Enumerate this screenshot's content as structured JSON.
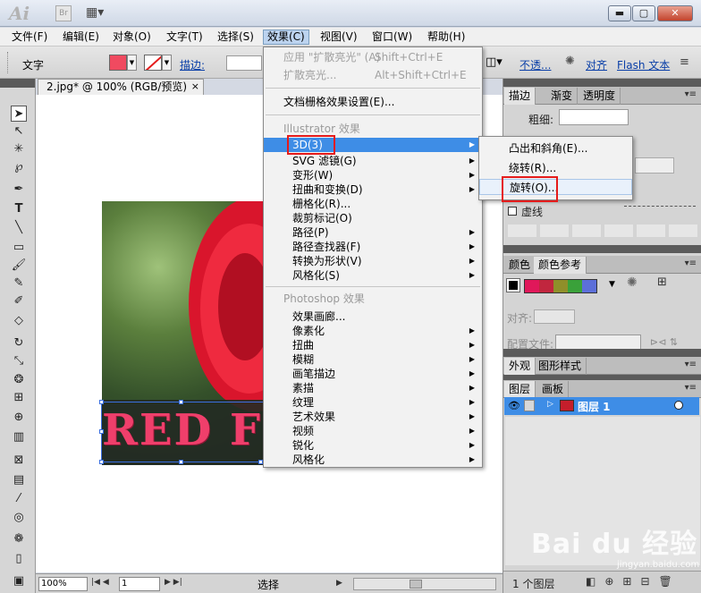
{
  "window": {
    "app_logo": "Ai",
    "bridge_label": "Br",
    "layout_icon": "layout-grid-icon",
    "buttons": [
      "minimize",
      "restore",
      "close"
    ]
  },
  "menubar": {
    "items": [
      "文件(F)",
      "编辑(E)",
      "对象(O)",
      "文字(T)",
      "选择(S)",
      "效果(C)",
      "视图(V)",
      "窗口(W)",
      "帮助(H)"
    ],
    "active": "效果(C)"
  },
  "controlbar": {
    "tool_label": "文字",
    "fill_color": "#f04a60",
    "stroke_label": "描边:",
    "opacity_label": "不透...",
    "align_label": "对齐",
    "flash_label": "Flash 文本"
  },
  "document": {
    "tab_title": "2.jpg* @ 100% (RGB/预览)",
    "close_glyph": "×",
    "overlay_text": "RED FL"
  },
  "statusbar": {
    "zoom": "100%",
    "page": "1",
    "status": "选择"
  },
  "effect_menu": {
    "top_items": [
      {
        "label": "应用 \"扩散亮光\" (A)",
        "shortcut": "Shift+Ctrl+E",
        "disabled": true
      },
      {
        "label": "扩散亮光...",
        "shortcut": "Alt+Shift+Ctrl+E",
        "disabled": true
      }
    ],
    "doc_settings": "文档栅格效果设置(E)...",
    "illustrator_header": "Illustrator 效果",
    "illustrator_items": [
      "3D(3)",
      "SVG 滤镜(G)",
      "变形(W)",
      "扭曲和变换(D)",
      "栅格化(R)...",
      "裁剪标记(O)",
      "路径(P)",
      "路径查找器(F)",
      "转换为形状(V)",
      "风格化(S)"
    ],
    "photoshop_header": "Photoshop 效果",
    "photoshop_items": [
      "效果画廊...",
      "像素化",
      "扭曲",
      "模糊",
      "画笔描边",
      "素描",
      "纹理",
      "艺术效果",
      "视频",
      "锐化",
      "风格化"
    ],
    "highlighted": "3D(3)"
  },
  "submenu_3d": {
    "items": [
      "凸出和斜角(E)...",
      "绕转(R)...",
      "旋转(O)..."
    ],
    "hovered": "旋转(O)..."
  },
  "panels": {
    "stroke_tabs": [
      "描边",
      "渐变",
      "透明度"
    ],
    "weight_label": "粗细:",
    "dashed_label": "虚线",
    "color_tabs": [
      "颜色",
      "颜色参考"
    ],
    "align_label": "对齐:",
    "preset_label": "配置文件:",
    "appearance_tabs": [
      "外观",
      "图形样式"
    ],
    "layer_tabs": [
      "图层",
      "画板"
    ],
    "layer_name": "图层 1",
    "layer_count": "1 个图层",
    "harmony_colors": [
      "#e0185a",
      "#c1263e",
      "#8f8f2a",
      "#3aa13a",
      "#5c6fd9"
    ]
  },
  "watermark": {
    "brand": "Bai du 经验",
    "url": "jingyan.baidu.com"
  }
}
